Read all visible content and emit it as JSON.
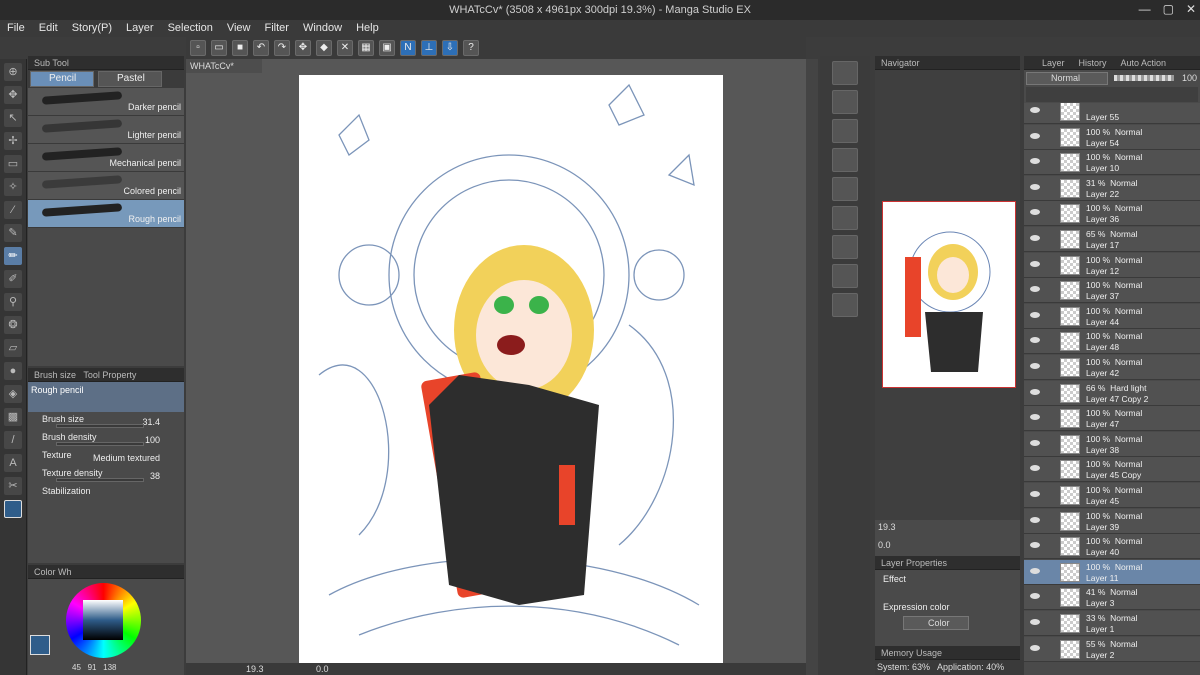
{
  "window": {
    "title": "WHATcCv* (3508 x 4961px 300dpi 19.3%) - Manga Studio EX",
    "minimize": "—",
    "maximize": "▢",
    "close": "✕"
  },
  "menu": [
    "File",
    "Edit",
    "Story(P)",
    "Layer",
    "Selection",
    "View",
    "Filter",
    "Window",
    "Help"
  ],
  "subtool": {
    "header": "Sub Tool",
    "tabs": [
      "Pencil",
      "Pastel"
    ],
    "brushes": [
      "Darker pencil",
      "Lighter pencil",
      "Mechanical pencil",
      "Colored pencil",
      "Rough pencil"
    ]
  },
  "toolprop": {
    "tabs": [
      "Brush size",
      "Tool Property"
    ],
    "preset": "Rough pencil",
    "rows": [
      {
        "name": "Brush size",
        "value": "31.4"
      },
      {
        "name": "Brush density",
        "value": "100"
      },
      {
        "name": "Texture",
        "value": "Medium textured"
      },
      {
        "name": "Texture density",
        "value": "38"
      },
      {
        "name": "Stabilization",
        "value": ""
      }
    ]
  },
  "color": {
    "header": "Color Wh",
    "r": "45",
    "g": "91",
    "b": "138",
    "main": "#2f5d8a"
  },
  "canvas": {
    "doc_tab": "WHATcCv*",
    "zoom": "19.3",
    "angle": "0.0"
  },
  "navigator": {
    "header": "Navigator",
    "zoom": "19.3",
    "angle": "0.0"
  },
  "layerprop": {
    "header": "Layer Properties",
    "effect": "Effect",
    "expression": "Expression color",
    "color_btn": "Color"
  },
  "memory": {
    "header": "Memory Usage",
    "system": "System: 63%",
    "application": "Application: 40%"
  },
  "layerpanel": {
    "tabs": [
      "Layer",
      "History",
      "Auto Action"
    ],
    "blend": "Normal",
    "opacity": "100"
  },
  "layers": [
    {
      "op": "",
      "mode": "",
      "name": "Layer 55"
    },
    {
      "op": "100 %",
      "mode": "Normal",
      "name": "Layer 54"
    },
    {
      "op": "100 %",
      "mode": "Normal",
      "name": "Layer 10"
    },
    {
      "op": "31 %",
      "mode": "Normal",
      "name": "Layer 22"
    },
    {
      "op": "100 %",
      "mode": "Normal",
      "name": "Layer 36"
    },
    {
      "op": "65 %",
      "mode": "Normal",
      "name": "Layer 17"
    },
    {
      "op": "100 %",
      "mode": "Normal",
      "name": "Layer 12"
    },
    {
      "op": "100 %",
      "mode": "Normal",
      "name": "Layer 37"
    },
    {
      "op": "100 %",
      "mode": "Normal",
      "name": "Layer 44"
    },
    {
      "op": "100 %",
      "mode": "Normal",
      "name": "Layer 48"
    },
    {
      "op": "100 %",
      "mode": "Normal",
      "name": "Layer 42"
    },
    {
      "op": "66 %",
      "mode": "Hard light",
      "name": "Layer 47 Copy 2"
    },
    {
      "op": "100 %",
      "mode": "Normal",
      "name": "Layer 47"
    },
    {
      "op": "100 %",
      "mode": "Normal",
      "name": "Layer 38"
    },
    {
      "op": "100 %",
      "mode": "Normal",
      "name": "Layer 45 Copy"
    },
    {
      "op": "100 %",
      "mode": "Normal",
      "name": "Layer 45"
    },
    {
      "op": "100 %",
      "mode": "Normal",
      "name": "Layer 39"
    },
    {
      "op": "100 %",
      "mode": "Normal",
      "name": "Layer 40"
    },
    {
      "op": "100 %",
      "mode": "Normal",
      "name": "Layer 11"
    },
    {
      "op": "41 %",
      "mode": "Normal",
      "name": "Layer 3"
    },
    {
      "op": "33 %",
      "mode": "Normal",
      "name": "Layer 1"
    },
    {
      "op": "55 %",
      "mode": "Normal",
      "name": "Layer 2"
    }
  ]
}
